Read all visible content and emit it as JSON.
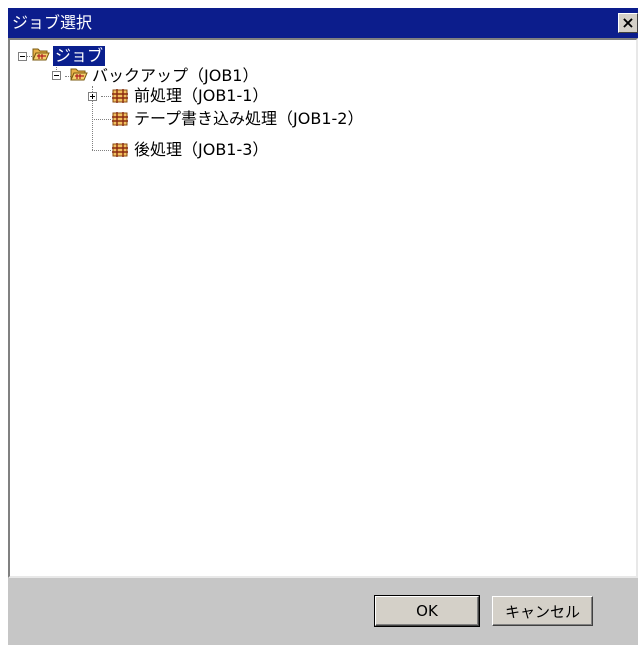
{
  "window": {
    "title": "ジョブ選択",
    "close_glyph": "×"
  },
  "tree": {
    "root": {
      "label": "ジョブ",
      "icon": "open-folder-icon",
      "selected": true
    },
    "group": {
      "label": "バックアップ（JOB1）",
      "icon": "open-folder-icon"
    },
    "jobs": [
      {
        "label": "前処理（JOB1-1）",
        "icon": "job-grid-icon",
        "has_children": true
      },
      {
        "label": "テープ書き込み処理（JOB1-2）",
        "icon": "job-grid-icon",
        "has_children": false
      },
      {
        "label": "後処理（JOB1-3）",
        "icon": "job-grid-icon",
        "has_children": false
      }
    ]
  },
  "buttons": {
    "ok_label": "OK",
    "cancel_label": "キャンセル"
  },
  "colors": {
    "titlebar": "#0c1d8c",
    "selection": "#0a1f8e",
    "dialog_bg": "#c6c6c6"
  }
}
